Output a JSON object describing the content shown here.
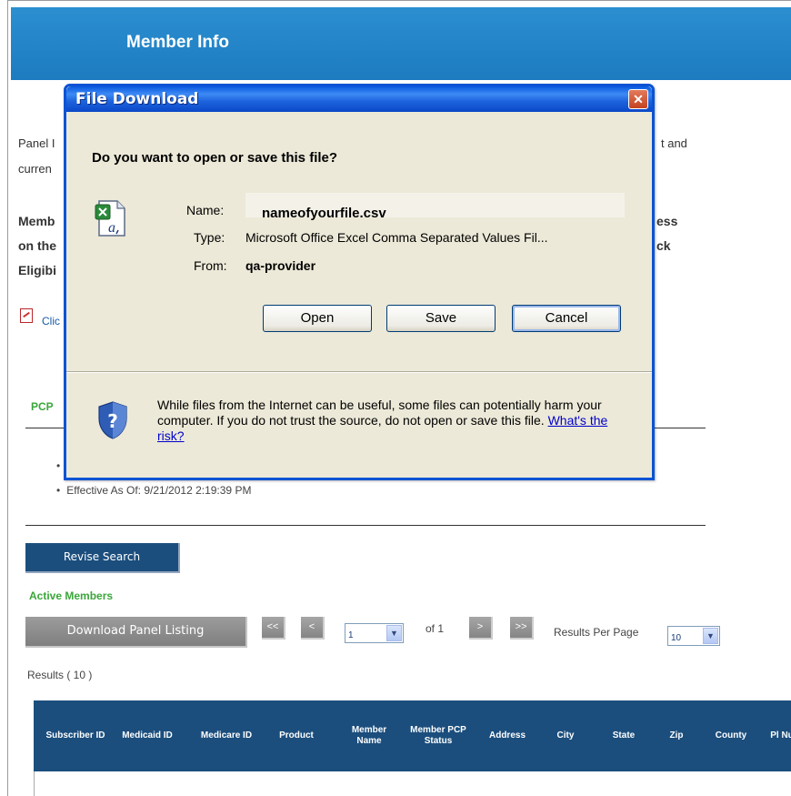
{
  "header": {
    "title": "Member Info"
  },
  "background": {
    "panel_fragment_1": "Panel I",
    "panel_fragment_1b": "t and",
    "panel_fragment_2": "curren",
    "bold_line_1_left": "Memb",
    "bold_line_1_right": "ess",
    "bold_line_2_left": "on the",
    "bold_line_2_right": "ck",
    "bold_line_3_left": "Eligibi",
    "pdf_link_fragment": "Clic",
    "pcp_label": "PCP",
    "effective_as_of": "Effective As Of: 9/21/2012 2:19:39 PM"
  },
  "controls": {
    "revise_search": "Revise Search",
    "active_members": "Active Members",
    "download_panel_listing": "Download Panel Listing",
    "first": "<<",
    "prev": "<",
    "page_value": "1",
    "of_pages": "of 1",
    "next": ">",
    "last": ">>",
    "results_per_page_label": "Results Per Page",
    "results_per_page_value": "10",
    "results_count": "Results ( 10 )"
  },
  "table": {
    "columns": [
      "Subscriber ID",
      "Medicaid ID",
      "Medicare ID",
      "Product",
      "Member Name",
      "Member PCP Status",
      "Address",
      "City",
      "State",
      "Zip",
      "County",
      "Pl Nu"
    ],
    "header_color": "#1b4e7d"
  },
  "dialog": {
    "title": "File Download",
    "close_glyph": "✕",
    "question": "Do you want to open or save this file?",
    "name_label": "Name:",
    "name_value": "nameofyourfile.csv",
    "type_label": "Type:",
    "type_value": "Microsoft Office Excel Comma Separated Values Fil...",
    "from_label": "From:",
    "from_value": "qa-provider",
    "open_button": "Open",
    "save_button": "Save",
    "cancel_button": "Cancel",
    "warning_text": "While files from the Internet can be useful, some files can potentially harm your computer. If you do not trust the source, do not open or save this file.",
    "risk_link": "What's the risk?"
  },
  "colors": {
    "header_blue": "#1d7bc0",
    "navy": "#1b4e7d",
    "green": "#3aa63a",
    "dialog_bg": "#ece9d8",
    "titlebar_blue": "#0a53d4"
  }
}
